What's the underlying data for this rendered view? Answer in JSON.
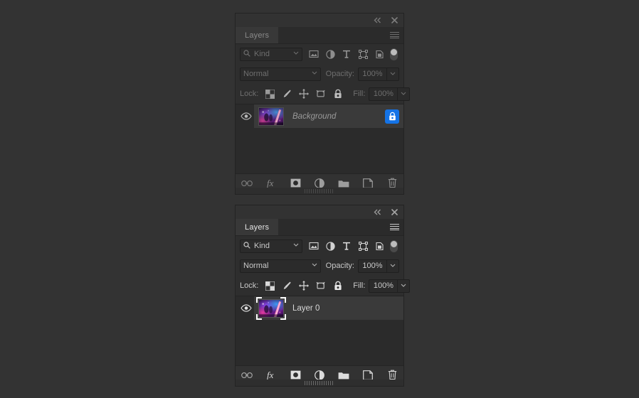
{
  "app": "Adobe Photoshop Layers Panel",
  "panels": [
    {
      "id": "panel-locked-background",
      "state": "inactive",
      "titlebar": {
        "collapse_icon": "collapse-double-chevron-icon",
        "close_icon": "close-icon"
      },
      "tab": {
        "label": "Layers",
        "menu_icon": "panel-menu-icon"
      },
      "filter": {
        "kind_label": "Kind",
        "search_icon": "search-icon",
        "chevron_icon": "chevron-down-icon",
        "type_icons": [
          "pixel-layer-filter-icon",
          "adjustment-layer-filter-icon",
          "type-layer-filter-icon",
          "shape-layer-filter-icon",
          "smart-object-filter-icon"
        ],
        "toggle_icon": "filter-enable-toggle"
      },
      "blend": {
        "mode": "Normal",
        "mode_chevron": "chevron-down-icon",
        "opacity_label": "Opacity:",
        "opacity_value": "100%",
        "opacity_chevron": "chevron-down-icon"
      },
      "lock": {
        "label": "Lock:",
        "icons": [
          "lock-transparent-pixels-icon",
          "lock-image-pixels-icon",
          "lock-position-icon",
          "lock-artboard-nesting-icon",
          "lock-all-icon"
        ],
        "fill_label": "Fill:",
        "fill_value": "100%",
        "fill_chevron": "chevron-down-icon"
      },
      "layers": [
        {
          "name": "Background",
          "italic": true,
          "visible": true,
          "visibility_icon": "eye-icon",
          "thumbnail": "layer-thumbnail",
          "thumbnail_selected": false,
          "locked": true,
          "lock_badge_icon": "lock-icon",
          "lock_badge_color": "#1473e6"
        }
      ],
      "bottom_toolbar": [
        "link-layers-icon",
        "layer-effects-fx-icon",
        "add-layer-mask-icon",
        "new-adjustment-layer-icon",
        "new-group-icon",
        "new-layer-icon",
        "delete-layer-icon"
      ],
      "grip_icon": "panel-resize-grip"
    },
    {
      "id": "panel-unlocked-layer0",
      "state": "active",
      "titlebar": {
        "collapse_icon": "collapse-double-chevron-icon",
        "close_icon": "close-icon"
      },
      "tab": {
        "label": "Layers",
        "menu_icon": "panel-menu-icon"
      },
      "filter": {
        "kind_label": "Kind",
        "search_icon": "search-icon",
        "chevron_icon": "chevron-down-icon",
        "type_icons": [
          "pixel-layer-filter-icon",
          "adjustment-layer-filter-icon",
          "type-layer-filter-icon",
          "shape-layer-filter-icon",
          "smart-object-filter-icon"
        ],
        "toggle_icon": "filter-enable-toggle"
      },
      "blend": {
        "mode": "Normal",
        "mode_chevron": "chevron-down-icon",
        "opacity_label": "Opacity:",
        "opacity_value": "100%",
        "opacity_chevron": "chevron-down-icon"
      },
      "lock": {
        "label": "Lock:",
        "icons": [
          "lock-transparent-pixels-icon",
          "lock-image-pixels-icon",
          "lock-position-icon",
          "lock-artboard-nesting-icon",
          "lock-all-icon"
        ],
        "fill_label": "Fill:",
        "fill_value": "100%",
        "fill_chevron": "chevron-down-icon"
      },
      "layers": [
        {
          "name": "Layer 0",
          "italic": false,
          "visible": true,
          "visibility_icon": "eye-icon",
          "thumbnail": "layer-thumbnail",
          "thumbnail_selected": true,
          "locked": false,
          "lock_badge_icon": "",
          "lock_badge_color": ""
        }
      ],
      "bottom_toolbar": [
        "link-layers-icon",
        "layer-effects-fx-icon",
        "add-layer-mask-icon",
        "new-adjustment-layer-icon",
        "new-group-icon",
        "new-layer-icon",
        "delete-layer-icon"
      ],
      "grip_icon": "panel-resize-grip"
    }
  ],
  "colors": {
    "page_background": "#333333",
    "panel_background": "#2e2e2e",
    "list_background": "#2b2b2b",
    "row_selected": "#3a3a3a",
    "accent_blue": "#1473e6",
    "text_inactive": "#6e6e6e",
    "text_active": "#c9c9c9"
  }
}
